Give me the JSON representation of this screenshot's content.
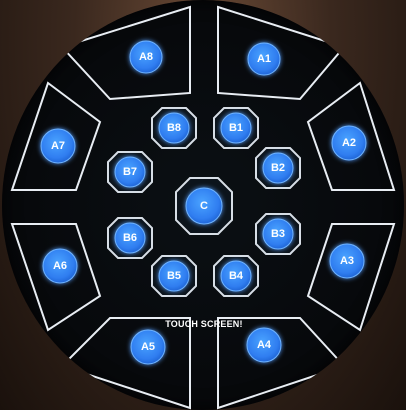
{
  "panel": {
    "notice": "TOUCH SCREEN!",
    "colors": {
      "button_fill": "#2f7df0",
      "button_glow": "#4aa3ff",
      "outline": "#e8edf3",
      "screen": "#07090c"
    },
    "outer_buttons": [
      {
        "id": "A1",
        "label": "A1"
      },
      {
        "id": "A2",
        "label": "A2"
      },
      {
        "id": "A3",
        "label": "A3"
      },
      {
        "id": "A4",
        "label": "A4"
      },
      {
        "id": "A5",
        "label": "A5"
      },
      {
        "id": "A6",
        "label": "A6"
      },
      {
        "id": "A7",
        "label": "A7"
      },
      {
        "id": "A8",
        "label": "A8"
      }
    ],
    "inner_buttons": [
      {
        "id": "B1",
        "label": "B1"
      },
      {
        "id": "B2",
        "label": "B2"
      },
      {
        "id": "B3",
        "label": "B3"
      },
      {
        "id": "B4",
        "label": "B4"
      },
      {
        "id": "B5",
        "label": "B5"
      },
      {
        "id": "B6",
        "label": "B6"
      },
      {
        "id": "B7",
        "label": "B7"
      },
      {
        "id": "B8",
        "label": "B8"
      }
    ],
    "center_button": {
      "id": "C",
      "label": "C"
    }
  }
}
